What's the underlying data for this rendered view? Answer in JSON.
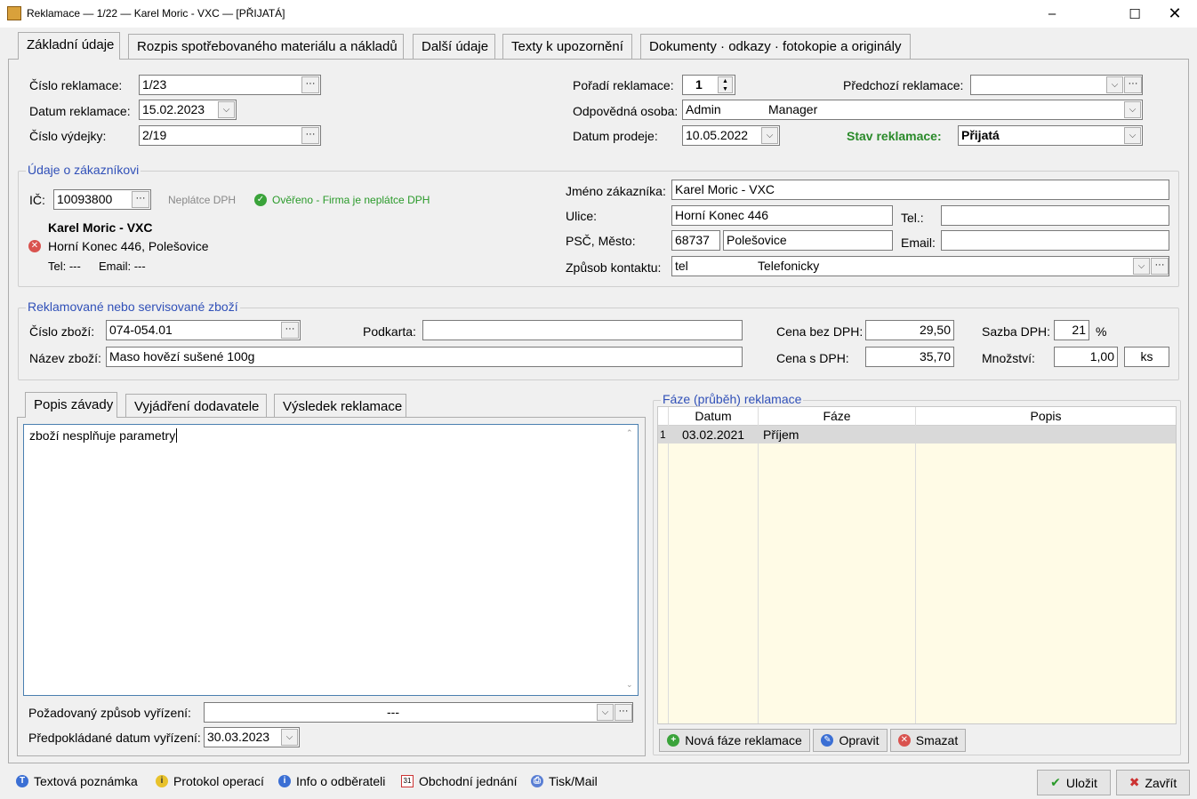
{
  "window": {
    "title": "Reklamace — 1/22 — Karel Moric - VXC — [PŘIJATÁ]"
  },
  "tabs": [
    "Základní údaje",
    "Rozpis spotřebovaného materiálu a nákladů",
    "Další údaje",
    "Texty k upozornění",
    "Dokumenty · odkazy · fotokopie a originály"
  ],
  "header": {
    "cislo_reklamace_label": "Číslo reklamace:",
    "cislo_reklamace": "1/23",
    "datum_reklamace_label": "Datum reklamace:",
    "datum_reklamace": "15.02.2023",
    "cislo_vydejky_label": "Číslo výdejky:",
    "cislo_vydejky": "2/19",
    "poradi_label": "Pořadí reklamace:",
    "poradi": "1",
    "predchozi_label": "Předchozí reklamace:",
    "predchozi": "",
    "osoba_label": "Odpovědná osoba:",
    "osoba_code": "Admin",
    "osoba_name": "Manager",
    "datum_prodeje_label": "Datum prodeje:",
    "datum_prodeje": "10.05.2022",
    "stav_label": "Stav reklamace:",
    "stav": "Přijatá"
  },
  "customer": {
    "group_title": "Údaje o zákazníkovi",
    "ic_label": "IČ:",
    "ic": "10093800",
    "neplatce": "Neplátce DPH",
    "overeno": "Ověřeno - Firma je neplátce DPH",
    "name_bold": "Karel Moric - VXC",
    "address_line": "Horní Konec 446,  Polešovice",
    "tel_line": "Tel: ---",
    "email_line": "Email: ---",
    "jmeno_label": "Jméno zákazníka:",
    "jmeno": "Karel Moric - VXC",
    "ulice_label": "Ulice:",
    "ulice": "Horní Konec 446",
    "tel_label": "Tel.:",
    "tel": "",
    "psc_label": "PSČ,  Město:",
    "psc": "68737",
    "mesto": "Polešovice",
    "email_label": "Email:",
    "email": "",
    "kontakt_label": "Způsob kontaktu:",
    "kontakt_code": "tel",
    "kontakt_name": "Telefonicky"
  },
  "goods": {
    "group_title": "Reklamované nebo servisované zboží",
    "cislo_label": "Číslo zboží:",
    "cislo": "074-054.01",
    "podkarta_label": "Podkarta:",
    "podkarta": "",
    "nazev_label": "Název zboží:",
    "nazev": "Maso hovězí sušené 100g",
    "cena_bez_label": "Cena bez DPH:",
    "cena_bez": "29,50",
    "cena_s_label": "Cena s DPH:",
    "cena_s": "35,70",
    "sazba_label": "Sazba DPH:",
    "sazba": "21",
    "pct": "%",
    "mnozstvi_label": "Množství:",
    "mnozstvi": "1,00",
    "jednotka": "ks"
  },
  "subtabs": [
    "Popis závady",
    "Vyjádření dodavatele",
    "Výsledek reklamace"
  ],
  "popis": {
    "text": "zboží nesplňuje parametry"
  },
  "vyrizeni": {
    "zpusob_label": "Požadovaný způsob vyřízení:",
    "zpusob": "---",
    "datum_label": "Předpokládané datum vyřízení:",
    "datum": "30.03.2023"
  },
  "faze": {
    "group_title": "Fáze (průběh) reklamace",
    "columns": [
      "Datum",
      "Fáze",
      "Popis"
    ],
    "rows": [
      {
        "n": "1",
        "datum": "03.02.2021",
        "faze": "Příjem",
        "popis": ""
      }
    ],
    "buttons": [
      "Nová fáze reklamace",
      "Opravit",
      "Smazat"
    ]
  },
  "footer": {
    "links": [
      "Textová poznámka",
      "Protokol operací",
      "Info o odběrateli",
      "Obchodní jednání",
      "Tisk/Mail"
    ],
    "save": "Uložit",
    "close": "Zavřít"
  },
  "colors": {
    "stav_label": "#2a8a2a",
    "group_title": "#3050b8",
    "overeno": "#2a9a2a",
    "grid_bg": "#fffbe6"
  }
}
